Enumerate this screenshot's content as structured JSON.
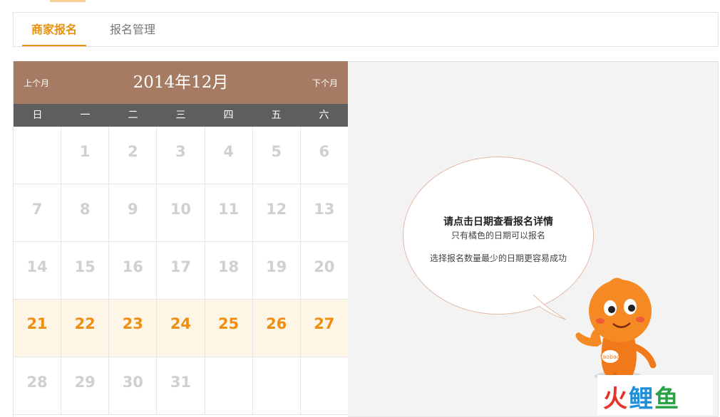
{
  "tabs": [
    {
      "label": "商家报名",
      "active": true
    },
    {
      "label": "报名管理",
      "active": false
    }
  ],
  "calendar": {
    "prev_label": "上个月",
    "next_label": "下个月",
    "title": "2014年12月",
    "weekdays": [
      "日",
      "一",
      "二",
      "三",
      "四",
      "五",
      "六"
    ],
    "rows": [
      [
        "",
        "1",
        "2",
        "3",
        "4",
        "5",
        "6"
      ],
      [
        "7",
        "8",
        "9",
        "10",
        "11",
        "12",
        "13"
      ],
      [
        "14",
        "15",
        "16",
        "17",
        "18",
        "19",
        "20"
      ],
      [
        "21",
        "22",
        "23",
        "24",
        "25",
        "26",
        "27"
      ],
      [
        "28",
        "29",
        "30",
        "31",
        "",
        "",
        ""
      ]
    ],
    "available_days": [
      "21",
      "22",
      "23",
      "24",
      "25",
      "26",
      "27"
    ]
  },
  "bubble": {
    "line1": "请点击日期查看报名详情",
    "line2": "只有橘色的日期可以报名",
    "line3": "选择报名数量最少的日期更容易成功"
  },
  "mascot": {
    "badge": "taobao"
  },
  "watermark": {
    "c1": "火",
    "c2": "鲤",
    "c3": "鱼"
  },
  "colors": {
    "accent": "#e8900b",
    "header_bg": "#a57b63",
    "weekday_bg": "#5e5e5e",
    "available_bg": "#fdf5e5",
    "available_text": "#ef8e12"
  }
}
